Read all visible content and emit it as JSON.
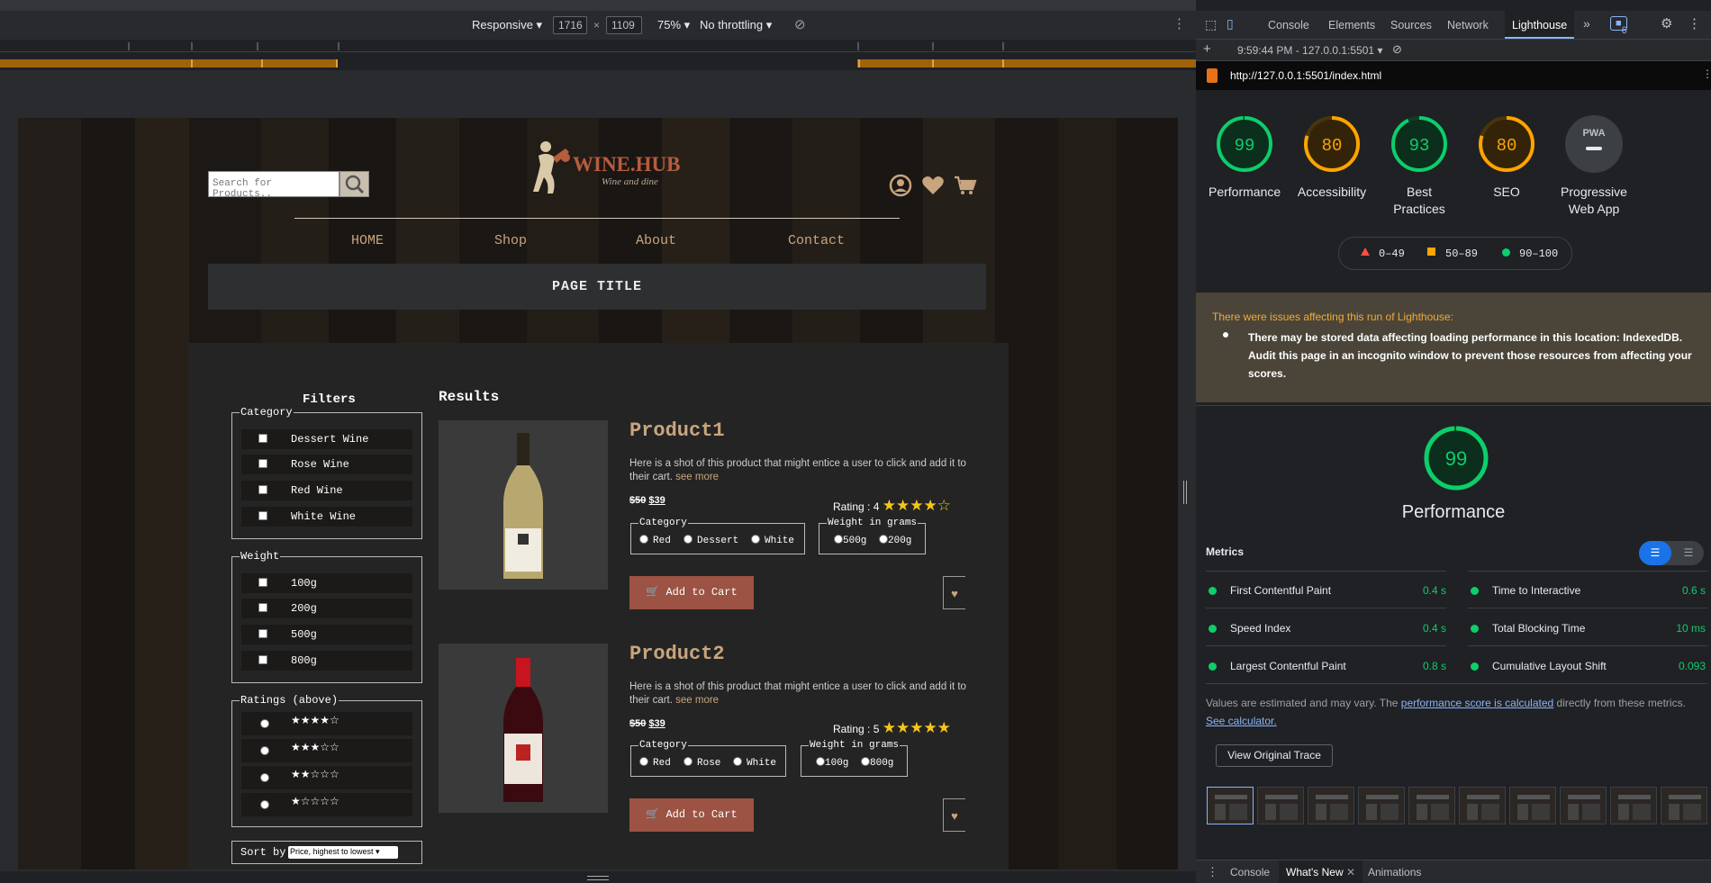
{
  "device_toolbar": {
    "mode": "Responsive",
    "width": "1716",
    "x": "×",
    "height": "1109",
    "zoom": "75%",
    "throttle": "No throttling"
  },
  "site": {
    "search_placeholder": "Search for Products..",
    "logo_title": "WINE.HUB",
    "logo_tagline": "Wine and dine",
    "nav": [
      "HOME",
      "Shop",
      "About",
      "Contact"
    ],
    "page_title": "PAGE TITLE",
    "filters_title": "Filters",
    "category_legend": "Category",
    "categories": [
      "Dessert Wine",
      "Rose Wine",
      "Red Wine",
      "White Wine"
    ],
    "weight_legend": "Weight",
    "weights": [
      "100g",
      "200g",
      "500g",
      "800g"
    ],
    "ratings_legend": "Ratings (above)",
    "rating_rows": [
      "★★★★☆",
      "★★★☆☆",
      "★★☆☆☆",
      "★☆☆☆☆"
    ],
    "sort_label": "Sort by",
    "sort_value": "Price, highest to lowest",
    "results_title": "Results",
    "products": [
      {
        "name": "Product1",
        "desc": "Here is a shot of this product that might entice a user to click and add it to their cart.",
        "see_more": "see more",
        "old_price": "$50",
        "price": "$39",
        "rating_label": "Rating : 4",
        "rating_stars": "★★★★☆",
        "rating_value": 4,
        "category_legend": "Category",
        "category_opts": [
          "Red",
          "Dessert",
          "White"
        ],
        "weight_legend": "Weight in grams",
        "weight_opts": [
          "500g",
          "200g"
        ],
        "cart": "Add to Cart",
        "bottle_color": "#c9b98a"
      },
      {
        "name": "Product2",
        "desc": "Here is a shot of this product that might entice a user to click and add it to their cart.",
        "see_more": "see more",
        "old_price": "$50",
        "price": "$39",
        "rating_label": "Rating : 5",
        "rating_stars": "★★★★★",
        "rating_value": 5,
        "category_legend": "Category",
        "category_opts": [
          "Red",
          "Rose",
          "White"
        ],
        "weight_legend": "Weight in grams",
        "weight_opts": [
          "100g",
          "800g"
        ],
        "cart": "Add to Cart",
        "bottle_color": "#5a0a12"
      }
    ]
  },
  "devtools": {
    "tabs": [
      "Console",
      "Elements",
      "Sources",
      "Network",
      "Lighthouse"
    ],
    "active_tab": "Lighthouse",
    "issues_count": "6",
    "run_label": "9:59:44 PM - 127.0.0.1:5501",
    "url": "http://127.0.0.1:5501/index.html",
    "scores": [
      {
        "value": "99",
        "label": "Performance",
        "color": "#0cce6b"
      },
      {
        "value": "80",
        "label": "Accessibility",
        "color": "#ffa400"
      },
      {
        "value": "93",
        "label": "Best Practices",
        "color": "#0cce6b"
      },
      {
        "value": "80",
        "label": "SEO",
        "color": "#ffa400"
      },
      {
        "value": "PWA",
        "label": "Progressive Web App",
        "color": "#9aa0a6"
      }
    ],
    "legend": [
      "0–49",
      "50–89",
      "90–100"
    ],
    "warning_title": "There were issues affecting this run of Lighthouse:",
    "warning_body": "There may be stored data affecting loading performance in this location: IndexedDB. Audit this page in an incognito window to prevent those resources from affecting your scores.",
    "perf_score": "99",
    "perf_label": "Performance",
    "metrics_title": "Metrics",
    "metrics": [
      {
        "name": "First Contentful Paint",
        "value": "0.4 s"
      },
      {
        "name": "Time to Interactive",
        "value": "0.6 s"
      },
      {
        "name": "Speed Index",
        "value": "0.4 s"
      },
      {
        "name": "Total Blocking Time",
        "value": "10 ms"
      },
      {
        "name": "Largest Contentful Paint",
        "value": "0.8 s"
      },
      {
        "name": "Cumulative Layout Shift",
        "value": "0.093"
      }
    ],
    "note_prefix": "Values are estimated and may vary. The ",
    "note_link": "performance score is calculated",
    "note_mid": " directly from these metrics. ",
    "note_link2": "See calculator.",
    "trace_button": "View Original Trace",
    "drawer_tabs": [
      "Console",
      "What's New",
      "Animations"
    ]
  }
}
